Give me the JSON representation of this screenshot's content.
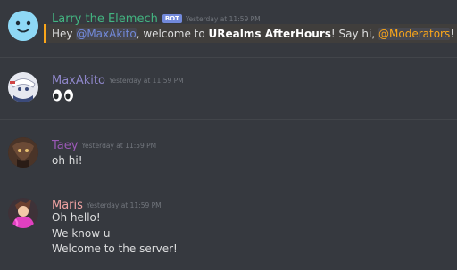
{
  "messages": [
    {
      "author": "Larry the Elemech",
      "author_color": "#43b581",
      "bot_tag": "BOT",
      "timestamp": "Yesterday at 11:59 PM",
      "avatar_icon": "bot-face-icon",
      "text": {
        "part1": "Hey ",
        "mention_user": "@MaxAkito",
        "part2": ", welcome to ",
        "server_name": "URealms AfterHours",
        "part3": "! Say hi, ",
        "mention_role": "@Moderators",
        "part4": "!"
      }
    },
    {
      "author": "MaxAkito",
      "author_color": "#8e86c9",
      "timestamp": "Yesterday at 11:59 PM",
      "avatar_icon": "anime-character-avatar",
      "content": "👀"
    },
    {
      "author": "Taey",
      "author_color": "#9b59b6",
      "timestamp": "Yesterday at 11:59 PM",
      "avatar_icon": "dark-creature-avatar",
      "content": "oh hi!"
    },
    {
      "author": "Maris",
      "author_color": "#f0a3a3",
      "timestamp": "Yesterday at 11:59 PM",
      "avatar_icon": "pink-character-avatar",
      "lines": [
        "Oh hello!",
        "We know u",
        "Welcome to the server!"
      ]
    }
  ]
}
